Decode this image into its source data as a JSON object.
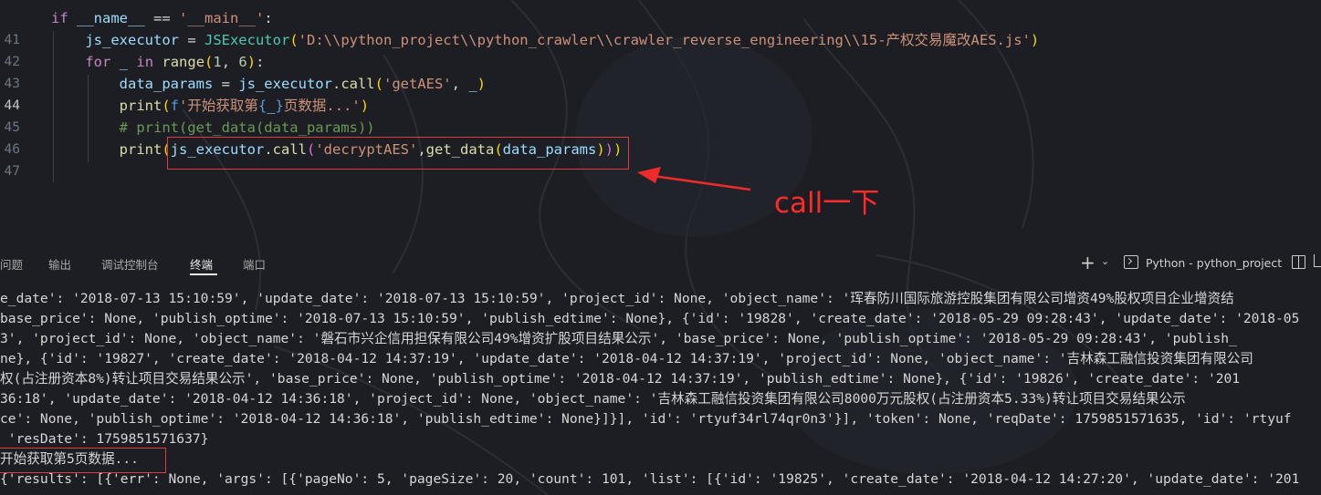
{
  "editor": {
    "lines": [
      {
        "num": "",
        "active": false,
        "tokens": [
          [
            "kw",
            "if"
          ],
          [
            "p",
            " "
          ],
          [
            "var",
            "__name__"
          ],
          [
            "p",
            " == "
          ],
          [
            "str",
            "'__main__'"
          ],
          [
            "p",
            ":"
          ]
        ]
      },
      {
        "num": "41",
        "active": false,
        "tokens": [
          [
            "p",
            "    "
          ],
          [
            "var",
            "js_executor"
          ],
          [
            "p",
            " = "
          ],
          [
            "cls",
            "JSExecutor"
          ],
          [
            "brk",
            "("
          ],
          [
            "str",
            "'D:\\\\python_project\\\\python_crawler\\\\crawler_reverse_engineering\\\\15-产权交易魔改AES.js'"
          ],
          [
            "brk",
            ")"
          ]
        ]
      },
      {
        "num": "42",
        "active": false,
        "tokens": [
          [
            "p",
            "    "
          ],
          [
            "kw",
            "for"
          ],
          [
            "p",
            " "
          ],
          [
            "var",
            "_"
          ],
          [
            "p",
            " "
          ],
          [
            "kw",
            "in"
          ],
          [
            "p",
            " "
          ],
          [
            "fn",
            "range"
          ],
          [
            "brk",
            "("
          ],
          [
            "num",
            "1"
          ],
          [
            "p",
            ", "
          ],
          [
            "num",
            "6"
          ],
          [
            "brk",
            ")"
          ],
          [
            "p",
            ":"
          ]
        ]
      },
      {
        "num": "43",
        "active": false,
        "tokens": [
          [
            "p",
            "        "
          ],
          [
            "var",
            "data_params"
          ],
          [
            "p",
            " = "
          ],
          [
            "var",
            "js_executor"
          ],
          [
            "p",
            "."
          ],
          [
            "fn",
            "call"
          ],
          [
            "brk",
            "("
          ],
          [
            "str",
            "'getAES'"
          ],
          [
            "p",
            ", "
          ],
          [
            "var",
            "_"
          ],
          [
            "brk",
            ")"
          ]
        ]
      },
      {
        "num": "44",
        "active": true,
        "tokens": [
          [
            "p",
            "        "
          ],
          [
            "fn",
            "print"
          ],
          [
            "brk",
            "("
          ],
          [
            "kw2",
            "f"
          ],
          [
            "str",
            "'开始获取第"
          ],
          [
            "kw2",
            "{"
          ],
          [
            "var",
            "_"
          ],
          [
            "kw2",
            "}"
          ],
          [
            "str",
            "页数据...'"
          ],
          [
            "brk",
            ")"
          ]
        ]
      },
      {
        "num": "45",
        "active": false,
        "tokens": [
          [
            "p",
            "        "
          ],
          [
            "cmt",
            "# print(get_data(data_params))"
          ]
        ]
      },
      {
        "num": "46",
        "active": false,
        "tokens": [
          [
            "p",
            "        "
          ],
          [
            "fn",
            "print"
          ],
          [
            "brk",
            "("
          ],
          [
            "var",
            "js_executor"
          ],
          [
            "p",
            "."
          ],
          [
            "fn",
            "call"
          ],
          [
            "brk2",
            "("
          ],
          [
            "str",
            "'decryptAES'"
          ],
          [
            "p",
            ","
          ],
          [
            "fn",
            "get_data"
          ],
          [
            "brk",
            "("
          ],
          [
            "var",
            "data_params"
          ],
          [
            "brk",
            ")"
          ],
          [
            "brk2",
            ")"
          ],
          [
            "brk",
            ")"
          ]
        ]
      },
      {
        "num": "47",
        "active": false,
        "tokens": []
      }
    ],
    "annotation": "call一下"
  },
  "panel": {
    "tabs": [
      "问题",
      "输出",
      "调试控制台",
      "终端",
      "端口"
    ],
    "active_tab": "终端",
    "terminal_name": "Python - python_project",
    "icons": [
      "plus-icon",
      "chevron-down-icon",
      "terminal-icon",
      "split-terminal-icon",
      "trash-icon"
    ]
  },
  "terminal": {
    "lines": [
      "e_date': '2018-07-13 15:10:59', 'update_date': '2018-07-13 15:10:59', 'project_id': None, 'object_name': '珲春防川国际旅游控股集团有限公司增资49%股权项目企业增资结",
      "base_price': None, 'publish_optime': '2018-07-13 15:10:59', 'publish_edtime': None}, {'id': '19828', 'create_date': '2018-05-29 09:28:43', 'update_date': '2018-05",
      "3', 'project_id': None, 'object_name': '磐石市兴企信用担保有限公司49%增资扩股项目结果公示', 'base_price': None, 'publish_optime': '2018-05-29 09:28:43', 'publish_",
      "ne}, {'id': '19827', 'create_date': '2018-04-12 14:37:19', 'update_date': '2018-04-12 14:37:19', 'project_id': None, 'object_name': '吉林森工融信投资集团有限公司",
      "权(占注册资本8%)转让项目交易结果公示', 'base_price': None, 'publish_optime': '2018-04-12 14:37:19', 'publish_edtime': None}, {'id': '19826', 'create_date': '201",
      "36:18', 'update_date': '2018-04-12 14:36:18', 'project_id': None, 'object_name': '吉林森工融信投资集团有限公司8000万元股权(占注册资本5.33%)转让项目交易结果公示",
      "ce': None, 'publish_optime': '2018-04-12 14:36:18', 'publish_edtime': None}]}], 'id': 'rtyuf34rl74qr0n3'}], 'token': None, 'reqDate': 1759851571635, 'id': 'rtyuf",
      " 'resDate': 1759851571637}",
      "开始获取第5页数据...",
      "{'results': [{'err': None, 'args': [{'pageNo': 5, 'pageSize': 20, 'count': 101, 'list': [{'id': '19825', 'create_date': '2018-04-12 14:27:20', 'update_date': '201"
    ]
  },
  "colors": {
    "highlight_box": "#e03b3b",
    "annotation_text": "#ff2b2b",
    "background": "#1c1e24"
  }
}
